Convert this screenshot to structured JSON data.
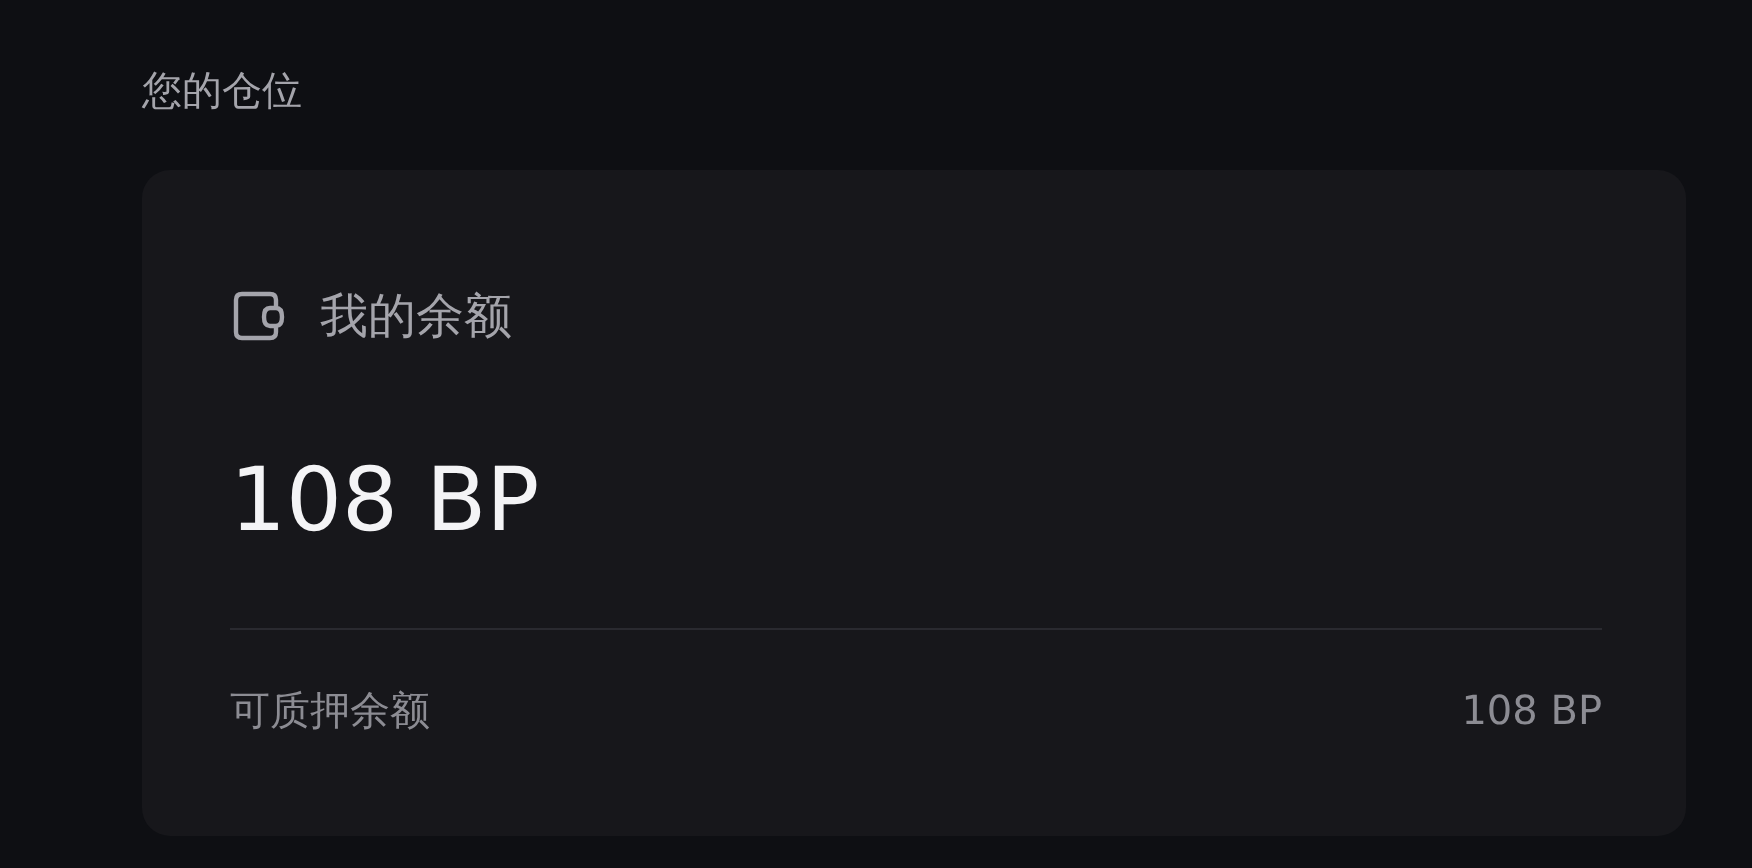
{
  "section_title": "您的仓位",
  "card": {
    "title": "我的余额",
    "balance": "108 BP",
    "rows": [
      {
        "label": "可质押余额",
        "value": "108 BP"
      }
    ]
  }
}
